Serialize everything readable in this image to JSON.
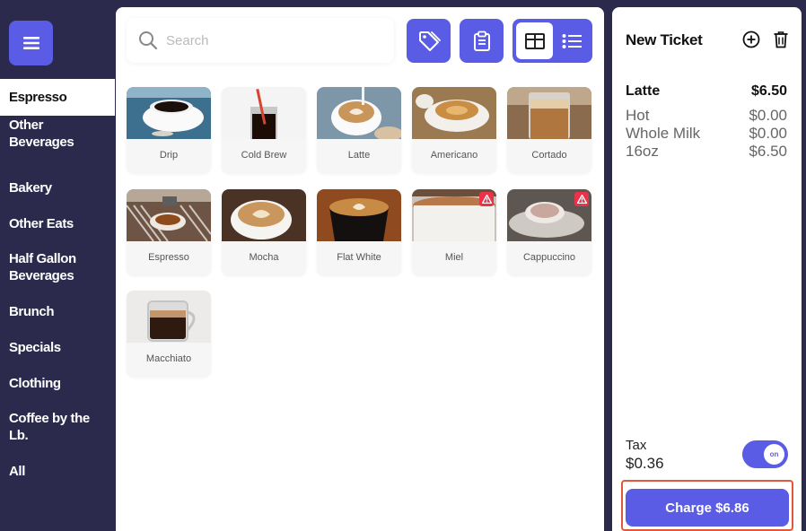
{
  "colors": {
    "accent": "#5b5ce6",
    "sidebar_bg": "#2b2a4c",
    "warning": "#e8334a",
    "highlight_outline": "#e2573a"
  },
  "sidebar": {
    "menu_icon": "hamburger-icon",
    "categories": [
      {
        "label": "Espresso",
        "active": true
      },
      {
        "label": "Other\nBeverages"
      },
      {
        "label": "Bakery"
      },
      {
        "label": "Other Eats"
      },
      {
        "label": "Half Gallon\nBeverages"
      },
      {
        "label": "Brunch"
      },
      {
        "label": "Specials"
      },
      {
        "label": "Clothing"
      },
      {
        "label": "Coffee by the\nLb."
      },
      {
        "label": "All"
      }
    ]
  },
  "search": {
    "placeholder": "Search",
    "icon": "search-icon"
  },
  "toolbar": {
    "tag_icon": "tag-icon",
    "clipboard_icon": "clipboard-icon",
    "grid_view_icon": "grid-view-icon",
    "list_view_icon": "list-view-icon",
    "active_view": "grid"
  },
  "products": [
    {
      "name": "Drip",
      "warning": false
    },
    {
      "name": "Cold Brew",
      "warning": false
    },
    {
      "name": "Latte",
      "warning": false
    },
    {
      "name": "Americano",
      "warning": false
    },
    {
      "name": "Cortado",
      "warning": false
    },
    {
      "name": "Espresso",
      "warning": false
    },
    {
      "name": "Mocha",
      "warning": false
    },
    {
      "name": "Flat White",
      "warning": false
    },
    {
      "name": "Miel",
      "warning": true
    },
    {
      "name": "Cappuccino",
      "warning": true
    },
    {
      "name": "Macchiato",
      "warning": false
    }
  ],
  "ticket": {
    "title": "New Ticket",
    "add_icon": "plus-circle-icon",
    "delete_icon": "trash-icon",
    "item": {
      "name": "Latte",
      "price": "$6.50",
      "modifiers": [
        {
          "name": "Hot",
          "price": "$0.00"
        },
        {
          "name": "Whole Milk",
          "price": "$0.00"
        },
        {
          "name": "16oz",
          "price": "$6.50"
        }
      ]
    },
    "tax_label": "Tax",
    "tax_value": "$0.36",
    "tax_toggle_label": "on",
    "tax_enabled": true,
    "charge_label": "Charge $6.86"
  }
}
